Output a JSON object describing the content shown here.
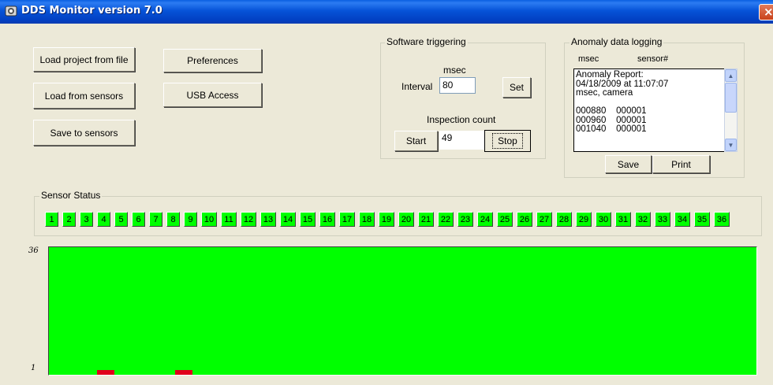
{
  "window": {
    "title": "DDS Monitor version 7.0"
  },
  "buttons": {
    "load_project": "Load project from file",
    "preferences": "Preferences",
    "load_sensors": "Load from sensors",
    "usb_access": "USB Access",
    "save_sensors": "Save to sensors"
  },
  "software_triggering": {
    "group_label": "Software triggering",
    "unit_label": "msec",
    "interval_label": "Interval",
    "interval_value": "80",
    "set_label": "Set",
    "inspection_label": "Inspection count",
    "start_label": "Start",
    "count_value": "49",
    "stop_label": "Stop"
  },
  "anomaly_logging": {
    "group_label": "Anomaly data logging",
    "col_msec": "msec",
    "col_sensor": "sensor#",
    "lines": [
      "Anomaly Report:",
      "04/18/2009 at 11:07:07",
      "msec, camera",
      "",
      "000880    000001",
      "000960    000001",
      "001040    000001"
    ],
    "save_label": "Save",
    "print_label": "Print"
  },
  "sensor_status": {
    "group_label": "Sensor Status",
    "sensors": [
      "1",
      "2",
      "3",
      "4",
      "5",
      "6",
      "7",
      "8",
      "9",
      "10",
      "11",
      "12",
      "13",
      "14",
      "15",
      "16",
      "17",
      "18",
      "19",
      "20",
      "21",
      "22",
      "23",
      "24",
      "25",
      "26",
      "27",
      "28",
      "29",
      "30",
      "31",
      "32",
      "33",
      "34",
      "35",
      "36"
    ],
    "color": "#00FF00"
  },
  "chart_data": {
    "type": "scatter",
    "y_max_label": "36",
    "y_min_label": "1",
    "ylim": [
      1,
      36
    ],
    "background": "#00FF00",
    "mark_color": "#E0001B",
    "anomalies": [
      {
        "sensor": 1,
        "x": 3
      },
      {
        "sensor": 1,
        "x": 7
      }
    ],
    "x_range": [
      0,
      36
    ]
  }
}
